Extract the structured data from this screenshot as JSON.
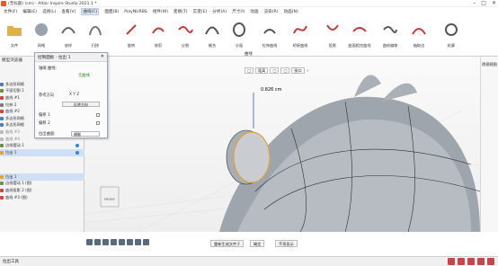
{
  "window": {
    "title": "(无标题) (cm) - Altair Inspire Studio 2021.1 *",
    "controls": [
      "–",
      "□",
      "✕"
    ]
  },
  "menu": {
    "items": [
      "文件(F)",
      "编辑(E)",
      "选视(L)",
      "查看(V)",
      "曲线(C)",
      "面面(B)",
      "PolyNURBS",
      "组件(W)",
      "变换(T)",
      "实变(E)",
      "分析(A)",
      "尺寸(I)",
      "动画",
      "渲染(R)",
      "动画(N)"
    ],
    "active": "曲线(C)"
  },
  "ribbon": {
    "items": [
      "文件",
      "网格",
      "放样",
      "扫掠",
      "旋转",
      "修剪",
      "分割",
      "缝合",
      "分面",
      "拉伸曲线",
      "桥接曲线",
      "投影",
      "曲面相交曲线",
      "曲线偏移",
      "抽取边",
      "轮廓"
    ],
    "group_label": "曲线"
  },
  "left_panel": {
    "title": "模型浏览器",
    "tree": [
      {
        "label": "多边形网格",
        "selected": false,
        "dim": false
      },
      {
        "label": "平面切割 1",
        "selected": false,
        "dim": false
      },
      {
        "label": "曲线 #1",
        "selected": false,
        "dim": false
      },
      {
        "label": "拉伸 2",
        "selected": false,
        "dim": false
      },
      {
        "label": "曲线 #2",
        "selected": false,
        "dim": false
      },
      {
        "label": "多边形网格",
        "selected": false,
        "dim": false
      },
      {
        "label": "多边形网格",
        "selected": false,
        "dim": false
      },
      {
        "label": "曲线 #3",
        "selected": false,
        "dim": true
      },
      {
        "label": "曲线 #4",
        "selected": false,
        "dim": true
      },
      {
        "label": "边线摆动 1",
        "selected": false,
        "dim": false
      },
      {
        "label": "拉出 1",
        "selected": true,
        "dim": false
      }
    ],
    "lower": [
      {
        "label": "拉出 1",
        "selected": true
      },
      {
        "label": "边线摆动 1 (图)",
        "selected": false
      },
      {
        "label": "曲线投影 2 (图)",
        "selected": false
      },
      {
        "label": "曲线 #3 (图)",
        "selected": false
      }
    ]
  },
  "dialog": {
    "title": "控制面板 - 拉出 1",
    "close": "✕",
    "curve_label": "轴阈 曲线：",
    "no_curve": "无曲线",
    "direction_label": "参考方向",
    "axes": "X Y Z",
    "reverse_btn": "反转方向",
    "offset1": "偏移 1",
    "offset2": "偏移 2",
    "extrude_label": "拉出曲面:",
    "extrude_value": "横截"
  },
  "viewport": {
    "measure": "0.826 cm",
    "toolbar": [
      "□",
      "距离",
      "□",
      "□",
      "接口"
    ],
    "toolbar_checked_label": "✓",
    "right_label": "透视视图",
    "view_cube_faces": [
      "FRONT",
      "RIGHT",
      "TOP"
    ]
  },
  "bottom_bar": {
    "buttons": [
      "重新生成文件于",
      "确定",
      "不再显示"
    ]
  },
  "status": {
    "text": "拉出工具"
  }
}
